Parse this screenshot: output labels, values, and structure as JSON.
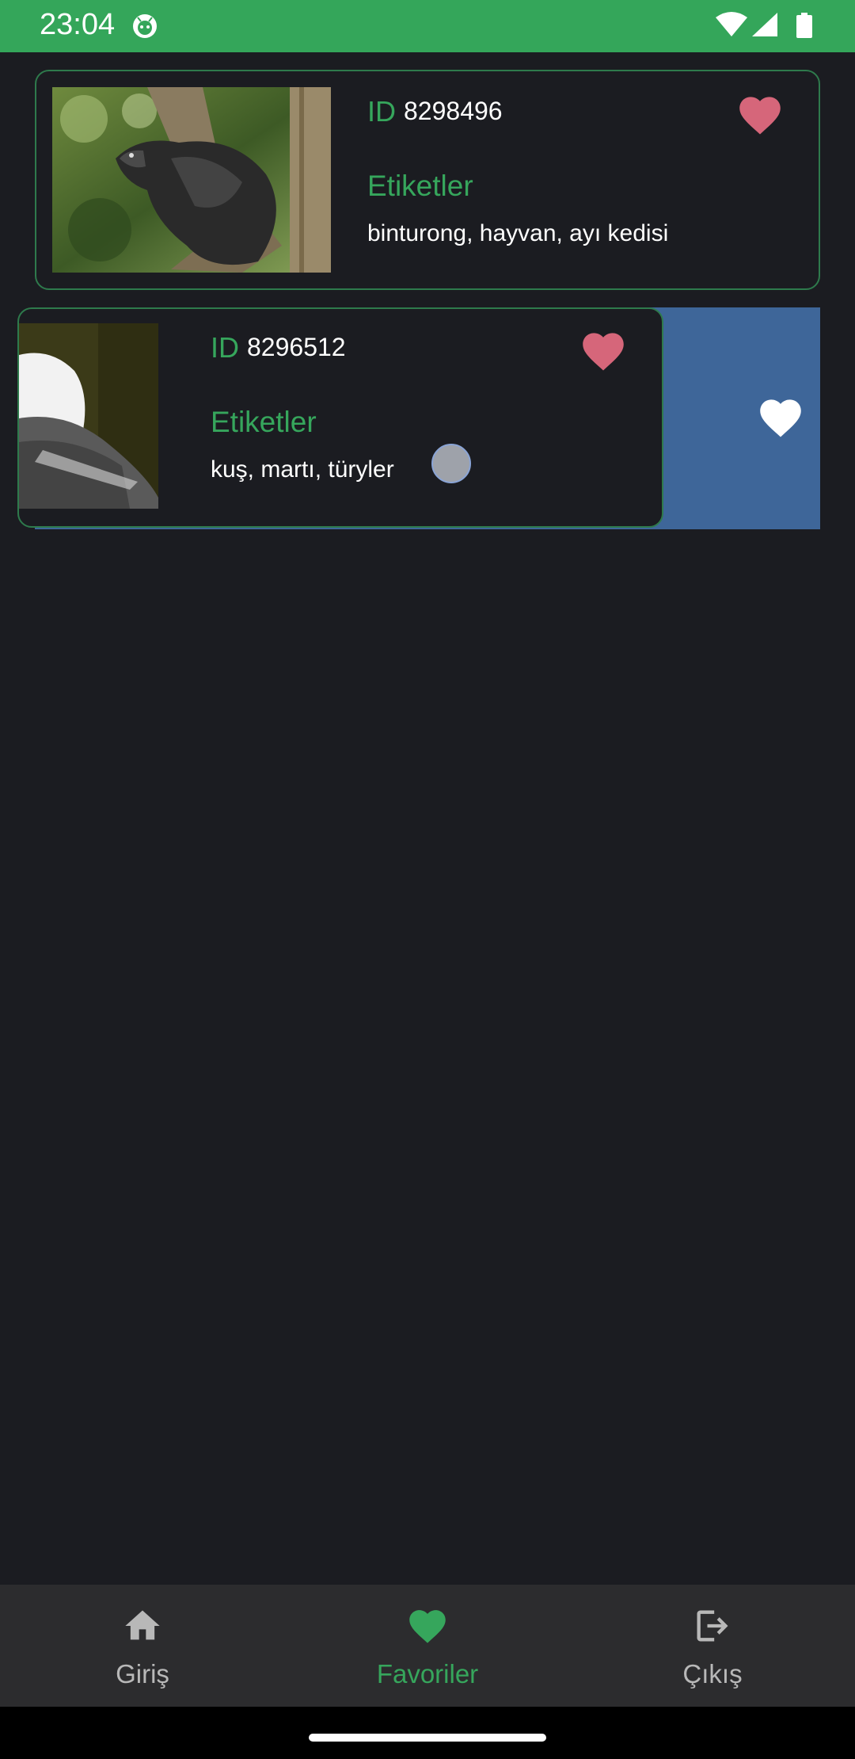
{
  "status_bar": {
    "time": "23:04",
    "icons": [
      "app-notification-icon",
      "wifi-icon",
      "signal-icon",
      "battery-icon"
    ]
  },
  "favorites": [
    {
      "id_label": "ID",
      "id_value": "8298496",
      "tags_label": "Etiketler",
      "tags": "binturong, hayvan, ayı kedisi"
    },
    {
      "id_label": "ID",
      "id_value": "8296512",
      "tags_label": "Etiketler",
      "tags": "kuş, martı, türyler"
    }
  ],
  "bottom_nav": {
    "items": [
      {
        "label": "Giriş",
        "icon": "home-icon"
      },
      {
        "label": "Favoriler",
        "icon": "heart-icon"
      },
      {
        "label": "Çıkış",
        "icon": "logout-icon"
      }
    ],
    "active": "Favoriler"
  },
  "colors": {
    "accent": "#36a65c",
    "status_bar": "#34a65a",
    "background": "#1b1c21",
    "heart": "#d6667a",
    "swipe_bg": "#3e6699",
    "nav_bg": "#2c2c2e"
  }
}
